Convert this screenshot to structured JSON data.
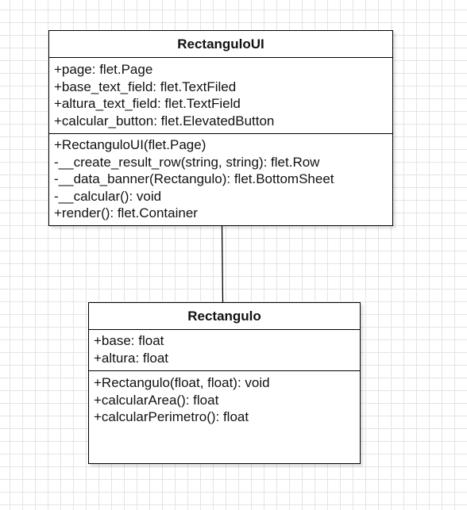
{
  "classes": {
    "rectangulo_ui": {
      "name": "RectanguloUI",
      "attributes": [
        "+page: flet.Page",
        "+base_text_field: flet.TextFiled",
        "+altura_text_field: flet.TextField",
        "+calcular_button: flet.ElevatedButton"
      ],
      "methods": [
        "+RectanguloUI(flet.Page)",
        "-__create_result_row(string, string): flet.Row",
        "-__data_banner(Rectangulo): flet.BottomSheet",
        "-__calcular(): void",
        "+render(): flet.Container"
      ]
    },
    "rectangulo": {
      "name": "Rectangulo",
      "attributes": [
        "+base: float",
        "+altura: float"
      ],
      "methods": [
        "+Rectangulo(float, float): void",
        "+calcularArea(): float",
        "+calcularPerimetro(): float"
      ]
    }
  }
}
